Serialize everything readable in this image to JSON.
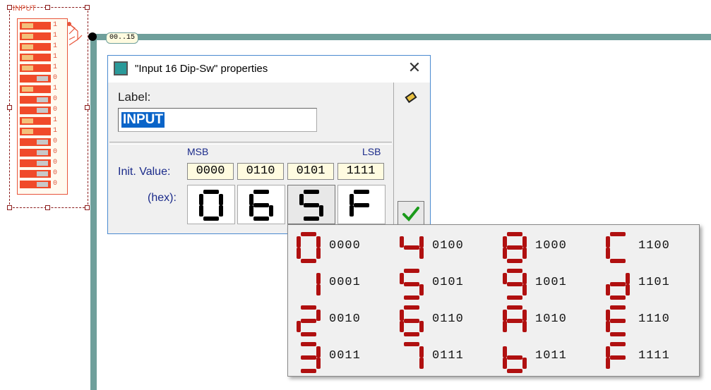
{
  "component": {
    "label": "INPUT",
    "bits": [
      "1",
      "1",
      "1",
      "1",
      "1",
      "0",
      "1",
      "0",
      "0",
      "1",
      "1",
      "0",
      "0",
      "0",
      "0",
      "0"
    ],
    "bus_tag": "00..15"
  },
  "dialog": {
    "title": "\"Input 16 Dip-Sw\" properties",
    "label_caption": "Label:",
    "label_value": "INPUT",
    "msb": "MSB",
    "lsb": "LSB",
    "init_caption": "Init. Value:",
    "hex_caption": "(hex):",
    "nibbles": [
      "0000",
      "0110",
      "0101",
      "1111"
    ],
    "hex_digits": [
      "0",
      "6",
      "5",
      "F"
    ]
  },
  "hex_table": [
    {
      "digit": "0",
      "bits": "0000"
    },
    {
      "digit": "1",
      "bits": "0001"
    },
    {
      "digit": "2",
      "bits": "0010"
    },
    {
      "digit": "3",
      "bits": "0011"
    },
    {
      "digit": "4",
      "bits": "0100"
    },
    {
      "digit": "5",
      "bits": "0101"
    },
    {
      "digit": "6",
      "bits": "0110"
    },
    {
      "digit": "7",
      "bits": "0111"
    },
    {
      "digit": "8",
      "bits": "1000"
    },
    {
      "digit": "9",
      "bits": "1001"
    },
    {
      "digit": "A",
      "bits": "1010"
    },
    {
      "digit": "b",
      "bits": "1011"
    },
    {
      "digit": "C",
      "bits": "1100"
    },
    {
      "digit": "d",
      "bits": "1101"
    },
    {
      "digit": "E",
      "bits": "1110"
    },
    {
      "digit": "F",
      "bits": "1111"
    }
  ],
  "colors": {
    "segment_red": "#b01010",
    "segment_black": "#000000",
    "bus": "#6f9f9b",
    "dip_red": "#f04a2a"
  },
  "icons": {
    "title": "dip-switch-icon",
    "close": "close-icon",
    "side": "chip-icon",
    "ok": "checkmark-icon"
  }
}
